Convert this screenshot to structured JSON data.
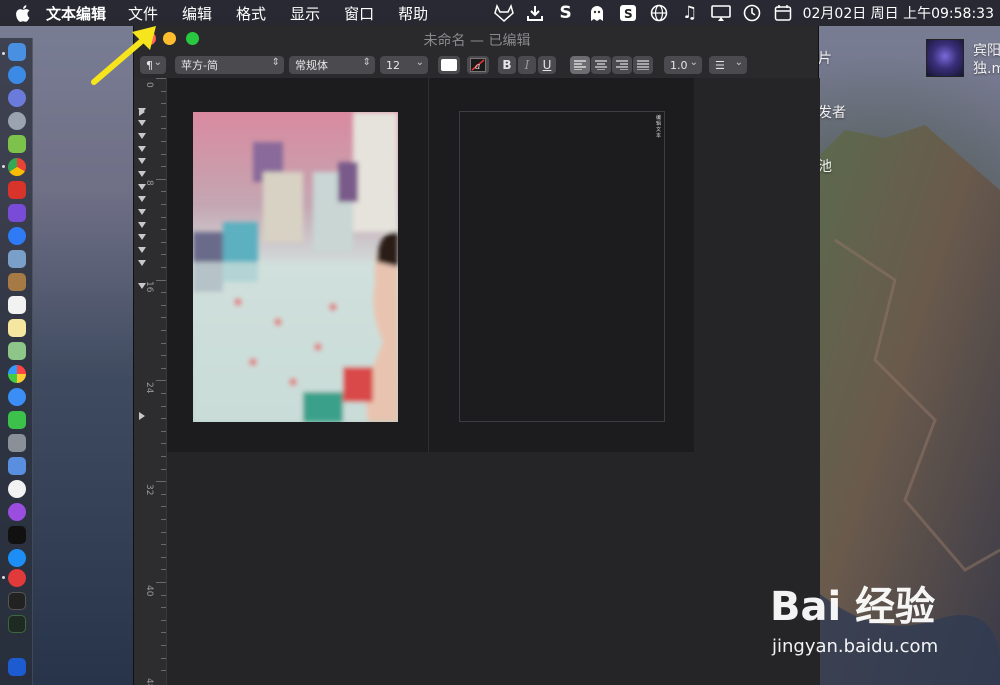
{
  "menubar": {
    "app_name": "文本编辑",
    "items": [
      "文件",
      "编辑",
      "格式",
      "显示",
      "窗口",
      "帮助"
    ],
    "clock": "02月02日 周日 上午09:58:33",
    "status_icons": [
      "gitlab-icon",
      "download-icon",
      "s-app-icon",
      "ghost-icon",
      "sogou-icon",
      "globe-icon",
      "music-icon",
      "display-icon",
      "time-machine-icon",
      "calendar-icon"
    ]
  },
  "window": {
    "title": "未命名 — 已编辑"
  },
  "toolbar": {
    "paragraph_style": "¶",
    "font_family": "苹方-简",
    "font_style": "常规体",
    "font_size": "12",
    "bold": "B",
    "italic": "I",
    "underline": "U",
    "line_spacing": "1.0",
    "list_style": "☰"
  },
  "ruler": {
    "numbers": [
      "0",
      "8",
      "16",
      "24",
      "32",
      "40",
      "48"
    ]
  },
  "document": {
    "text_box_content": "编辑文本"
  },
  "desktop": {
    "labels_right": [
      "片",
      "发者",
      "池"
    ],
    "now_playing_line1": "宾阳",
    "now_playing_line2": "独.m"
  },
  "watermark": {
    "logo": "Bai 经验",
    "url": "jingyan.baidu.com"
  },
  "colors": {
    "accent_arrow": "#f6e51c",
    "window_bg": "#2a2a2c",
    "close": "#fe5f57",
    "minimize": "#febc2e",
    "maximize": "#28c840"
  }
}
